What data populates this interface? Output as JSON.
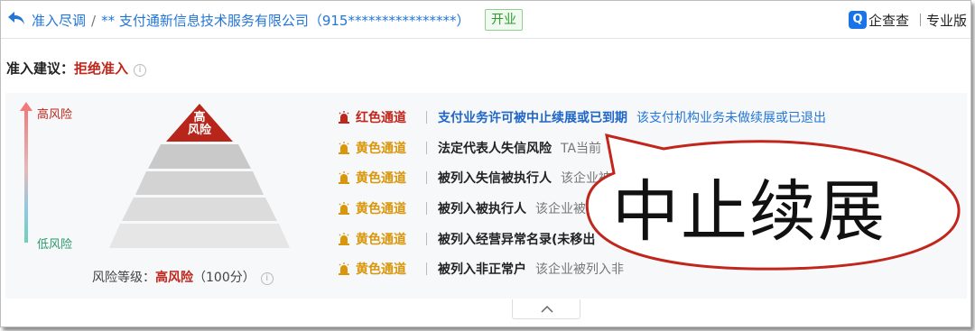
{
  "header": {
    "breadcrumb_root": "准入尽调",
    "breadcrumb_sep": "/",
    "company": "** 支付通新信息技术服务有限公司（915****************）",
    "status": "开业",
    "brand_logo": "Q",
    "brand_name": "企查查",
    "edition": "专业版"
  },
  "suggestion": {
    "label": "准入建议：",
    "value": "拒绝准入"
  },
  "pyramid": {
    "top_label_line1": "高",
    "top_label_line2": "风险",
    "axis_high": "高风险",
    "axis_low": "低风险",
    "colors": {
      "top": "#b8261b",
      "levels": "#c9c9c9"
    }
  },
  "grade": {
    "label": "风险等级：",
    "value": "高风险",
    "score": "（100分）"
  },
  "rows": [
    {
      "channel": "红色通道",
      "title": "支付业务许可被中止续展或已到期",
      "desc": "该支付机构业务未做续展或已退出"
    },
    {
      "channel": "黄色通道",
      "title": "法定代表人失信风险",
      "desc": "TA当前"
    },
    {
      "channel": "黄色通道",
      "title": "被列入失信被执行人",
      "desc": "该企业被"
    },
    {
      "channel": "黄色通道",
      "title": "被列入被执行人",
      "desc": "该企业被"
    },
    {
      "channel": "黄色通道",
      "title": "被列入经营异常名录(未移出",
      "desc": ""
    },
    {
      "channel": "黄色通道",
      "title": "被列入非正常户",
      "desc": "该企业被列入非"
    }
  ],
  "callout": {
    "text": "中止续展"
  },
  "colors": {
    "red": "#c0261b",
    "yellow": "#d9960a",
    "link": "#2376d6"
  }
}
